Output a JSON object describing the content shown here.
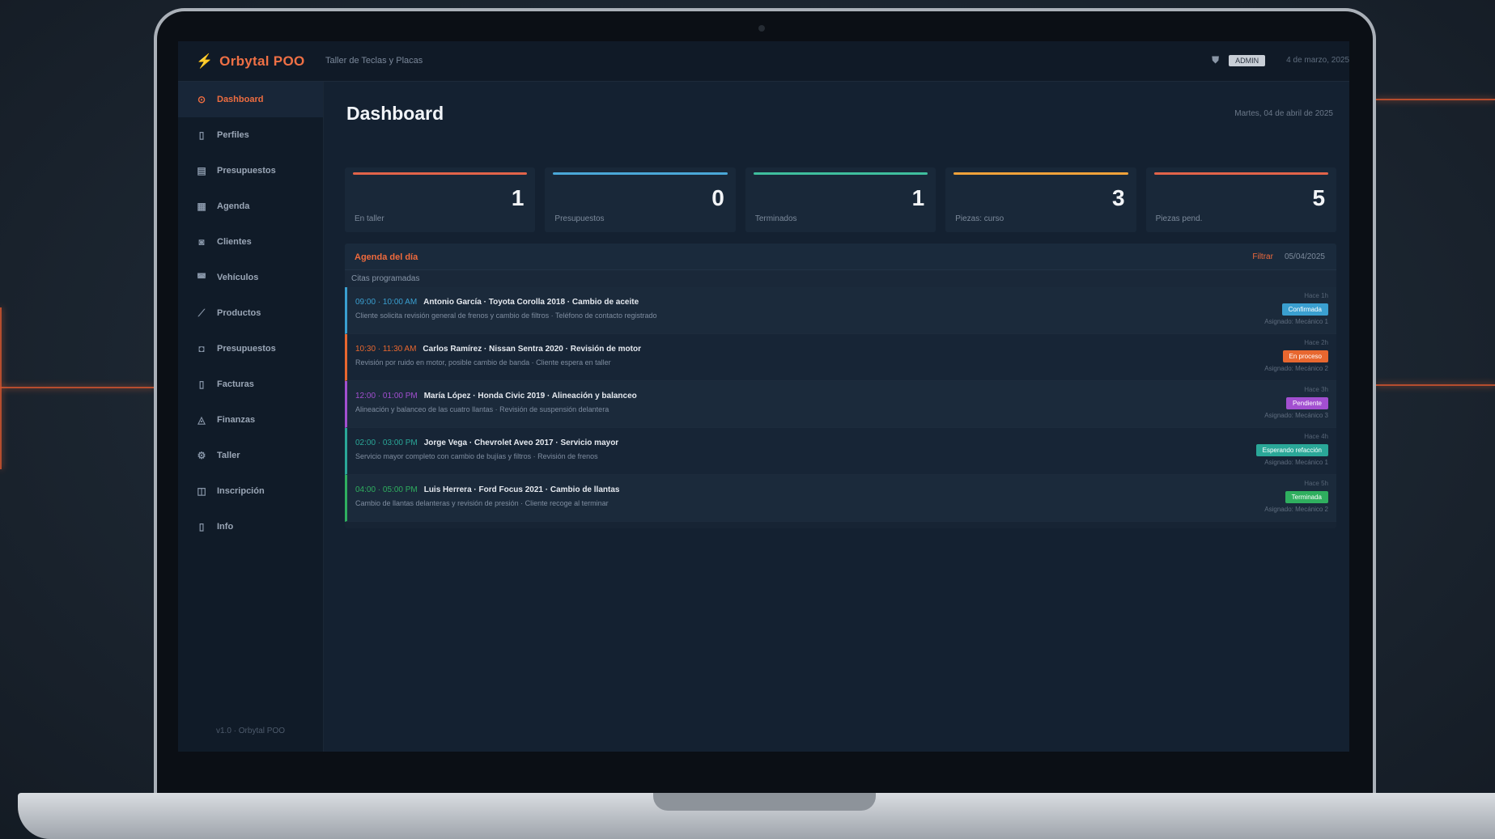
{
  "brand": {
    "name": "Orbytal POO"
  },
  "topbar": {
    "subtitle": "Taller de Teclas y Placas",
    "badge": "ADMIN",
    "meta": "4 de marzo, 2025"
  },
  "sidebar": {
    "items": [
      {
        "label": "Dashboard",
        "icon": "dashboard-icon",
        "glyph": "⊙",
        "active": true
      },
      {
        "label": "Perfiles",
        "icon": "profile-icon",
        "glyph": "▯",
        "active": false
      },
      {
        "label": "Presupuestos",
        "icon": "budget-icon",
        "glyph": "▤",
        "active": false
      },
      {
        "label": "Agenda",
        "icon": "calendar-icon",
        "glyph": "▦",
        "active": false
      },
      {
        "label": "Clientes",
        "icon": "clients-icon",
        "glyph": "◙",
        "active": false
      },
      {
        "label": "Vehículos",
        "icon": "car-icon",
        "glyph": "◚",
        "active": false
      },
      {
        "label": "Productos",
        "icon": "wrench-icon",
        "glyph": "⟋",
        "active": false
      },
      {
        "label": "Presupuestos",
        "icon": "briefcase-icon",
        "glyph": "◘",
        "active": false
      },
      {
        "label": "Facturas",
        "icon": "invoice-icon",
        "glyph": "▯",
        "active": false
      },
      {
        "label": "Finanzas",
        "icon": "finance-icon",
        "glyph": "◬",
        "active": false
      },
      {
        "label": "Taller",
        "icon": "gear-icon",
        "glyph": "⚙",
        "active": false
      },
      {
        "label": "Inscripción",
        "icon": "register-icon",
        "glyph": "◫",
        "active": false
      },
      {
        "label": "Info",
        "icon": "info-icon",
        "glyph": "▯",
        "active": false
      }
    ],
    "footer": "v1.0 · Orbytal POO"
  },
  "main": {
    "title": "Dashboard",
    "date": "Martes, 04 de abril de 2025"
  },
  "stats": [
    {
      "value": "1",
      "label": "En taller",
      "color": "#e2644a"
    },
    {
      "value": "0",
      "label": "Presupuestos",
      "color": "#4aa8d8"
    },
    {
      "value": "1",
      "label": "Terminados",
      "color": "#3fbf9e"
    },
    {
      "value": "3",
      "label": "Piezas: curso",
      "color": "#f0a23a"
    },
    {
      "value": "5",
      "label": "Piezas pend.",
      "color": "#e2644a"
    }
  ],
  "agenda": {
    "title": "Agenda del día",
    "action_primary": "Filtrar",
    "action_secondary": "05/04/2025",
    "subheader": "Citas programadas",
    "rows": [
      {
        "time": "09:00 · 10:00 AM",
        "title": "Antonio García · Toyota Corolla 2018 · Cambio de aceite",
        "desc": "Cliente solicita revisión general de frenos y cambio de filtros · Teléfono de contacto registrado",
        "right_top": "Hace 1h",
        "badge": "Confirmada",
        "badge_color": "#3a9fd0",
        "right_bottom": "Asignado: Mecánico 1",
        "accent": "#3a9fd0",
        "time_color": "#3a9fd0"
      },
      {
        "time": "10:30 · 11:30 AM",
        "title": "Carlos Ramírez · Nissan Sentra 2020 · Revisión de motor",
        "desc": "Revisión por ruido en motor, posible cambio de banda · Cliente espera en taller",
        "right_top": "Hace 2h",
        "badge": "En proceso",
        "badge_color": "#e8672f",
        "right_bottom": "Asignado: Mecánico 2",
        "accent": "#e8672f",
        "time_color": "#e8672f"
      },
      {
        "time": "12:00 · 01:00 PM",
        "title": "María López · Honda Civic 2019 · Alineación y balanceo",
        "desc": "Alineación y balanceo de las cuatro llantas · Revisión de suspensión delantera",
        "right_top": "Hace 3h",
        "badge": "Pendiente",
        "badge_color": "#a24fd0",
        "right_bottom": "Asignado: Mecánico 3",
        "accent": "#a24fd0",
        "time_color": "#a24fd0"
      },
      {
        "time": "02:00 · 03:00 PM",
        "title": "Jorge Vega · Chevrolet Aveo 2017 · Servicio mayor",
        "desc": "Servicio mayor completo con cambio de bujías y filtros · Revisión de frenos",
        "right_top": "Hace 4h",
        "badge": "Esperando refacción",
        "badge_color": "#2aa798",
        "right_bottom": "Asignado: Mecánico 1",
        "accent": "#2aa798",
        "time_color": "#2aa798"
      },
      {
        "time": "04:00 · 05:00 PM",
        "title": "Luis Herrera · Ford Focus 2021 · Cambio de llantas",
        "desc": "Cambio de llantas delanteras y revisión de presión · Cliente recoge al terminar",
        "right_top": "Hace 5h",
        "badge": "Terminada",
        "badge_color": "#2faf5f",
        "right_bottom": "Asignado: Mecánico 2",
        "accent": "#2faf5f",
        "time_color": "#2faf5f"
      }
    ]
  },
  "colors": {
    "accent": "#ef6a3c",
    "background": "#142131"
  }
}
